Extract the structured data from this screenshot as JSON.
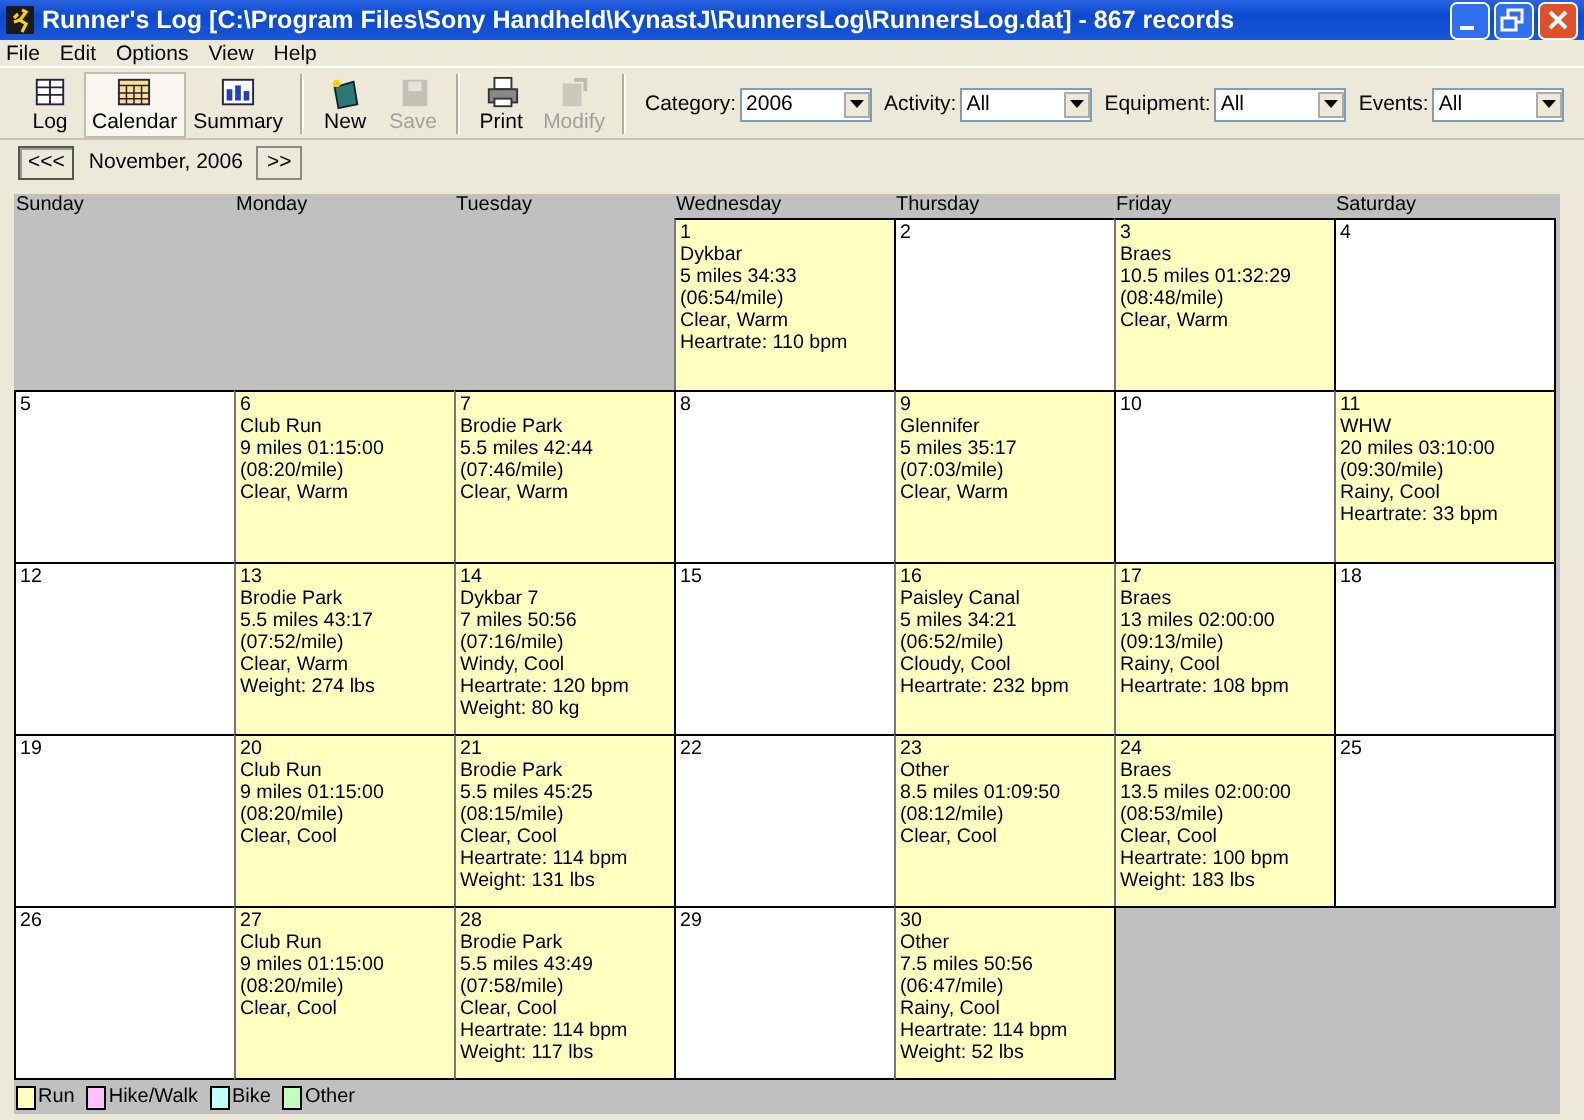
{
  "window": {
    "title": "Runner's Log [C:\\Program Files\\Sony Handheld\\KynastJ\\RunnersLog\\RunnersLog.dat] - 867 records"
  },
  "menu": [
    "File",
    "Edit",
    "Options",
    "View",
    "Help"
  ],
  "toolbar": [
    {
      "label": "Log",
      "kind": "log",
      "selected": false,
      "disabled": false
    },
    {
      "label": "Calendar",
      "kind": "calendar",
      "selected": true,
      "disabled": false
    },
    {
      "label": "Summary",
      "kind": "summary",
      "selected": false,
      "disabled": false
    },
    {
      "label": "New",
      "kind": "new",
      "selected": false,
      "disabled": false
    },
    {
      "label": "Save",
      "kind": "save",
      "selected": false,
      "disabled": true
    },
    {
      "label": "Print",
      "kind": "print",
      "selected": false,
      "disabled": false
    },
    {
      "label": "Modify",
      "kind": "modify",
      "selected": false,
      "disabled": true
    }
  ],
  "filters": [
    {
      "label": "Category:",
      "value": "2006"
    },
    {
      "label": "Activity:",
      "value": "All"
    },
    {
      "label": "Equipment:",
      "value": "All"
    },
    {
      "label": "Events:",
      "value": "All"
    }
  ],
  "nav": {
    "prev": "<<<",
    "month": "November, 2006",
    "next": ">>"
  },
  "weekdays": [
    "Sunday",
    "Monday",
    "Tuesday",
    "Wednesday",
    "Thursday",
    "Friday",
    "Saturday"
  ],
  "weeks": [
    [
      {
        "kind": "empty"
      },
      {
        "kind": "empty"
      },
      {
        "kind": "empty"
      },
      {
        "kind": "day",
        "date": "1",
        "color": "#ffffc0",
        "lines": [
          "Dykbar",
          "5 miles 34:33",
          "(06:54/mile)",
          "Clear, Warm",
          "Heartrate: 110 bpm"
        ]
      },
      {
        "kind": "day",
        "date": "2"
      },
      {
        "kind": "day",
        "date": "3",
        "color": "#ffffc0",
        "lines": [
          "Braes",
          "10.5 miles 01:32:29",
          "(08:48/mile)",
          "Clear, Warm"
        ]
      },
      {
        "kind": "day",
        "date": "4"
      }
    ],
    [
      {
        "kind": "day",
        "date": "5"
      },
      {
        "kind": "day",
        "date": "6",
        "color": "#ffffc0",
        "lines": [
          "Club Run",
          "9 miles 01:15:00",
          "(08:20/mile)",
          "Clear, Warm"
        ]
      },
      {
        "kind": "day",
        "date": "7",
        "color": "#ffffc0",
        "lines": [
          "Brodie Park",
          "5.5 miles 42:44",
          "(07:46/mile)",
          "Clear, Warm"
        ]
      },
      {
        "kind": "day",
        "date": "8"
      },
      {
        "kind": "day",
        "date": "9",
        "color": "#ffffc0",
        "lines": [
          "Glennifer",
          "5 miles 35:17",
          "(07:03/mile)",
          "Clear, Warm"
        ]
      },
      {
        "kind": "day",
        "date": "10"
      },
      {
        "kind": "day",
        "date": "11",
        "color": "#ffffc0",
        "lines": [
          "WHW",
          "20 miles 03:10:00",
          "(09:30/mile)",
          "Rainy, Cool",
          "Heartrate: 33 bpm"
        ]
      }
    ],
    [
      {
        "kind": "day",
        "date": "12"
      },
      {
        "kind": "day",
        "date": "13",
        "color": "#ffffc0",
        "lines": [
          "Brodie Park",
          "5.5 miles 43:17",
          "(07:52/mile)",
          "Clear, Warm",
          "Weight: 274 lbs"
        ]
      },
      {
        "kind": "day",
        "date": "14",
        "color": "#ffffc0",
        "lines": [
          "Dykbar 7",
          "7 miles 50:56",
          "(07:16/mile)",
          "Windy, Cool",
          "Heartrate: 120 bpm",
          "Weight: 80 kg"
        ]
      },
      {
        "kind": "day",
        "date": "15"
      },
      {
        "kind": "day",
        "date": "16",
        "color": "#ffffc0",
        "lines": [
          "Paisley Canal",
          "5 miles 34:21",
          "(06:52/mile)",
          "Cloudy, Cool",
          "Heartrate: 232 bpm"
        ]
      },
      {
        "kind": "day",
        "date": "17",
        "color": "#ffffc0",
        "lines": [
          "Braes",
          "13 miles 02:00:00",
          "(09:13/mile)",
          "Rainy, Cool",
          "Heartrate: 108 bpm"
        ]
      },
      {
        "kind": "day",
        "date": "18"
      }
    ],
    [
      {
        "kind": "day",
        "date": "19"
      },
      {
        "kind": "day",
        "date": "20",
        "color": "#ffffc0",
        "lines": [
          "Club Run",
          "9 miles 01:15:00",
          "(08:20/mile)",
          "Clear, Cool"
        ]
      },
      {
        "kind": "day",
        "date": "21",
        "color": "#ffffc0",
        "lines": [
          "Brodie Park",
          "5.5 miles 45:25",
          "(08:15/mile)",
          "Clear, Cool",
          "Heartrate: 114 bpm",
          "Weight: 131 lbs"
        ]
      },
      {
        "kind": "day",
        "date": "22"
      },
      {
        "kind": "day",
        "date": "23",
        "color": "#ffffc0",
        "lines": [
          "Other",
          "8.5 miles 01:09:50",
          "(08:12/mile)",
          "Clear, Cool"
        ]
      },
      {
        "kind": "day",
        "date": "24",
        "color": "#ffffc0",
        "lines": [
          "Braes",
          "13.5 miles 02:00:00",
          "(08:53/mile)",
          "Clear, Cool",
          "Heartrate: 100 bpm",
          "Weight: 183 lbs"
        ]
      },
      {
        "kind": "day",
        "date": "25"
      }
    ],
    [
      {
        "kind": "day",
        "date": "26"
      },
      {
        "kind": "day",
        "date": "27",
        "color": "#ffffc0",
        "lines": [
          "Club Run",
          "9 miles 01:15:00",
          "(08:20/mile)",
          "Clear, Cool"
        ]
      },
      {
        "kind": "day",
        "date": "28",
        "color": "#ffffc0",
        "lines": [
          "Brodie Park",
          "5.5 miles 43:49",
          "(07:58/mile)",
          "Clear, Cool",
          "Heartrate: 114 bpm",
          "Weight: 117 lbs"
        ]
      },
      {
        "kind": "day",
        "date": "29"
      },
      {
        "kind": "day",
        "date": "30",
        "color": "#ffffc0",
        "lines": [
          "Other",
          "7.5 miles 50:56",
          "(06:47/mile)",
          "Rainy, Cool",
          "Heartrate: 114 bpm",
          "Weight: 52 lbs"
        ]
      },
      {
        "kind": "empty"
      },
      {
        "kind": "empty"
      }
    ]
  ],
  "legend": [
    {
      "label": "Run",
      "color": "#ffffc0"
    },
    {
      "label": "Hike/Walk",
      "color": "#ffc0ff"
    },
    {
      "label": "Bike",
      "color": "#c0ffff"
    },
    {
      "label": "Other",
      "color": "#c0ffc0"
    }
  ]
}
